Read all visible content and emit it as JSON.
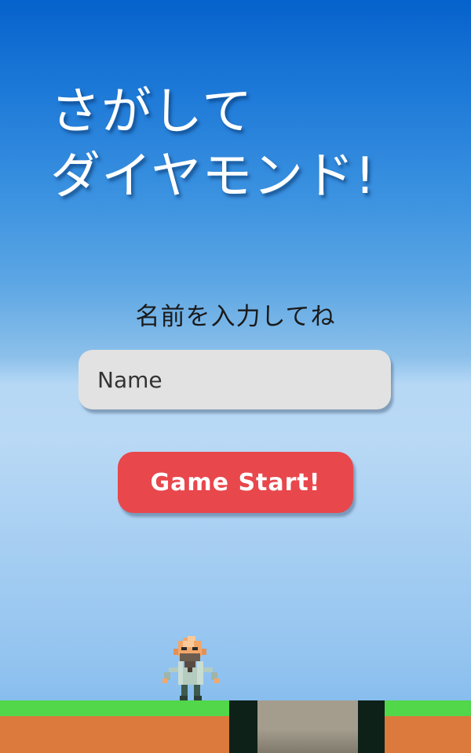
{
  "game": {
    "title_line1": "さがして",
    "title_line2": "ダイヤモンド!",
    "prompt": "名前を入力してね",
    "name_input": {
      "placeholder": "Name",
      "value": ""
    },
    "start_button_label": "Game Start!"
  },
  "colors": {
    "button": "#e8474c",
    "input": "#e2e2e2",
    "grass": "#52d64a",
    "dirt": "#db7a3c",
    "sky_top": "#0662cc",
    "sky_bottom": "#85bcee"
  },
  "icons": {
    "player": "pixel-old-man-sprite"
  }
}
